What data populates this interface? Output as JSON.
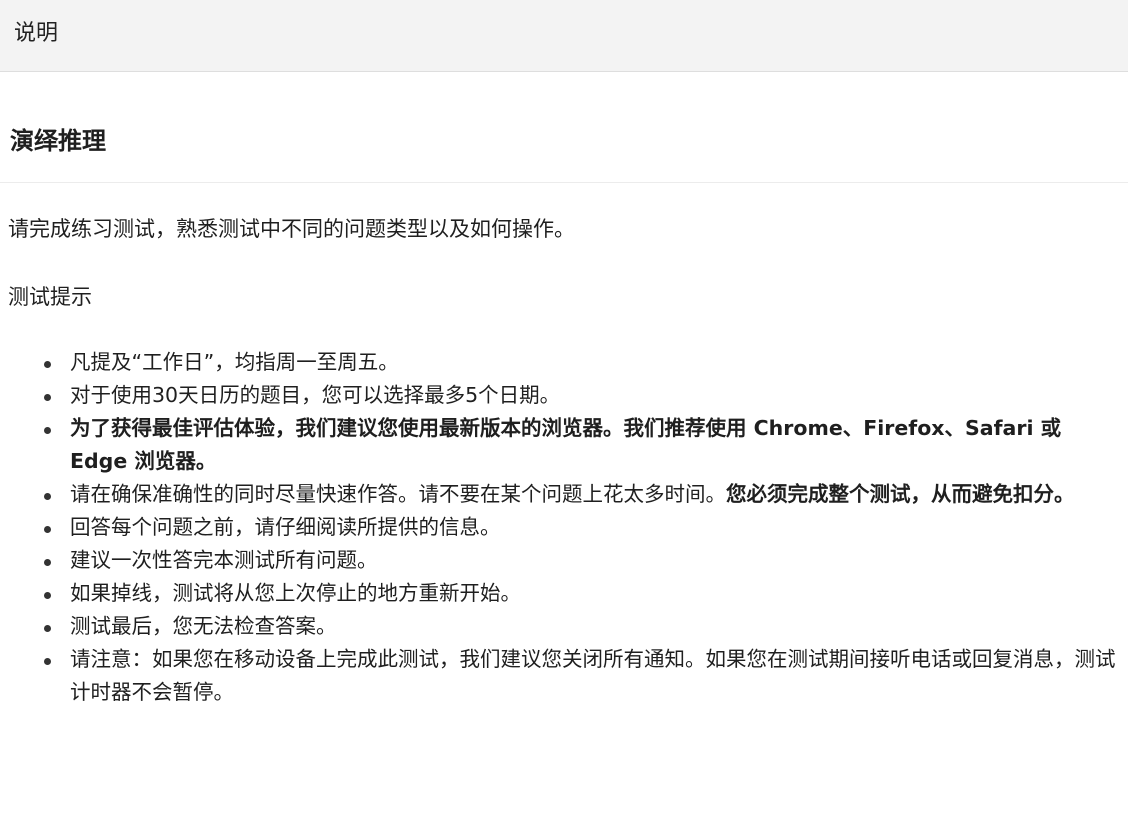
{
  "header": {
    "title": "说明"
  },
  "section": {
    "title": "演绎推理"
  },
  "main": {
    "intro": "请完成练习测试，熟悉测试中不同的问题类型以及如何操作。",
    "tips_label": "测试提示",
    "tips": [
      {
        "normal": "凡提及“工作日”，均指周一至周五。",
        "bold": ""
      },
      {
        "normal": "对于使用30天日历的题目，您可以选择最多5个日期。",
        "bold": ""
      },
      {
        "normal": "",
        "bold": "为了获得最佳评估体验，我们建议您使用最新版本的浏览器。我们推荐使用 Chrome、Firefox、Safari 或 Edge 浏览器。"
      },
      {
        "normal": "请在确保准确性的同时尽量快速作答。请不要在某个问题上花太多时间。",
        "bold": "您必须完成整个测试，从而避免扣分。"
      },
      {
        "normal": "回答每个问题之前，请仔细阅读所提供的信息。",
        "bold": ""
      },
      {
        "normal": "建议一次性答完本测试所有问题。",
        "bold": ""
      },
      {
        "normal": "如果掉线，测试将从您上次停止的地方重新开始。",
        "bold": ""
      },
      {
        "normal": "测试最后，您无法检查答案。",
        "bold": ""
      },
      {
        "normal": "请注意：如果您在移动设备上完成此测试，我们建议您关闭所有通知。如果您在测试期间接听电话或回复消息，测试计时器不会暂停。",
        "bold": ""
      }
    ]
  }
}
